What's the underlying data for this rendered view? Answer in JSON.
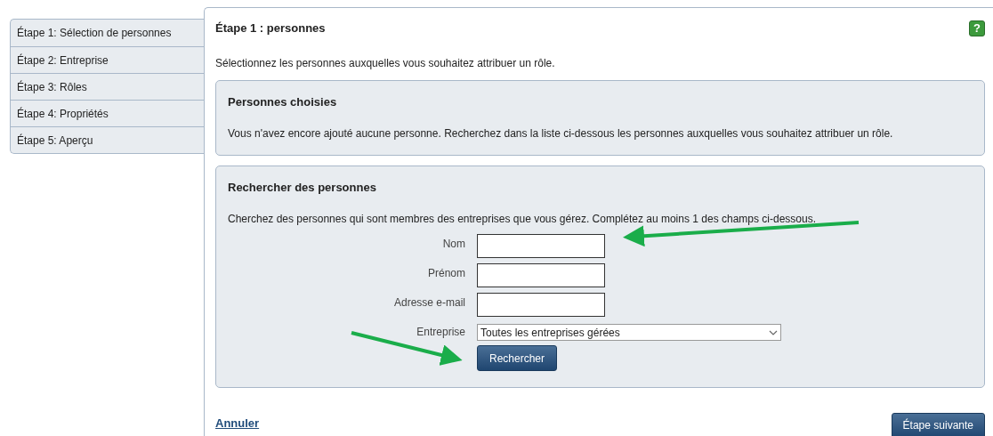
{
  "steps": [
    {
      "label": "Étape 1: Sélection de personnes"
    },
    {
      "label": "Étape 2: Entreprise"
    },
    {
      "label": "Étape 3: Rôles"
    },
    {
      "label": "Étape 4: Propriétés"
    },
    {
      "label": "Étape 5: Aperçu"
    }
  ],
  "title": "Étape 1 : personnes",
  "help": "?",
  "intro": "Sélectionnez les personnes auxquelles vous souhaitez attribuer un rôle.",
  "chosen": {
    "heading": "Personnes choisies",
    "text": "Vous n'avez encore ajouté aucune personne. Recherchez dans la liste ci-dessous les personnes auxquelles vous souhaitez attribuer un rôle."
  },
  "search": {
    "heading": "Rechercher des personnes",
    "text": "Cherchez des personnes qui sont membres des entreprises que vous gérez. Complétez au moins 1 des champs ci-dessous.",
    "fields": [
      {
        "kind": "text",
        "label": "Nom"
      },
      {
        "kind": "text",
        "label": "Prénom"
      },
      {
        "kind": "text",
        "label": "Adresse e-mail"
      },
      {
        "kind": "select",
        "label": "Entreprise",
        "value": "Toutes les entreprises gérées"
      }
    ],
    "button": "Rechercher"
  },
  "cancel": "Annuler",
  "next": "Étape suivante"
}
